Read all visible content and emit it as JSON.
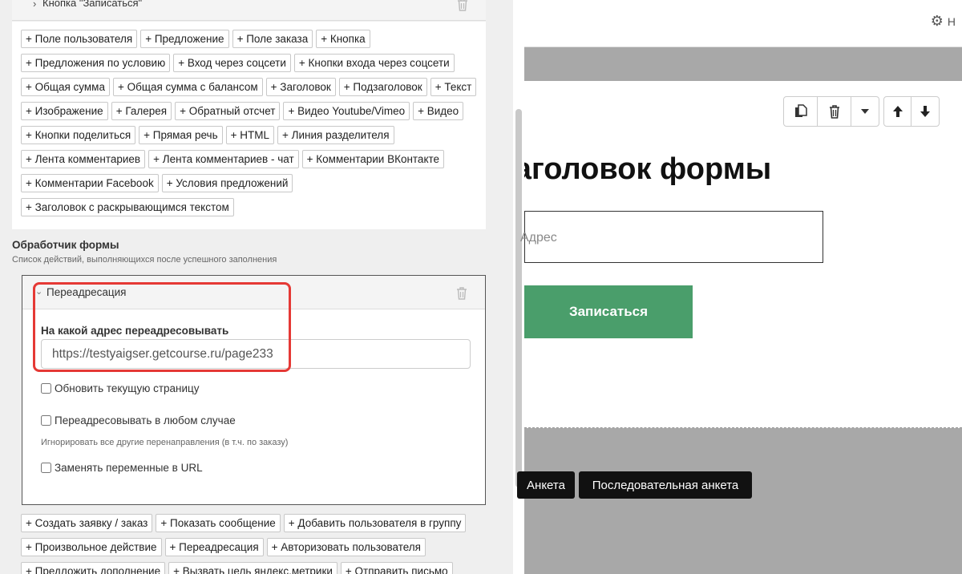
{
  "top_card": {
    "label": "Кнопка \"Записаться\""
  },
  "add_blocks": [
    "+ Поле пользователя",
    "+ Предложение",
    "+ Поле заказа",
    "+ Кнопка",
    "+ Предложения по условию",
    "+ Вход через соцсети",
    "+ Кнопки входа через соцсети",
    "+ Общая сумма",
    "+ Общая сумма с балансом",
    "+ Заголовок",
    "+ Подзаголовок",
    "+ Текст",
    "+ Изображение",
    "+ Галерея",
    "+ Обратный отсчет",
    "+ Видео Youtube/Vimeo",
    "+ Видео",
    "+ Кнопки поделиться",
    "+ Прямая речь",
    "+ HTML",
    "+ Линия разделителя",
    "+ Лента комментариев",
    "+ Лента комментариев - чат",
    "+ Комментарии ВКонтакте",
    "+ Комментарии Facebook",
    "+ Условия предложений",
    "+ Заголовок с раскрывающимся текстом"
  ],
  "handler": {
    "title": "Обработчик формы",
    "subtitle": "Список действий, выполняющихся после успешного заполнения"
  },
  "redirect": {
    "header": "Переадресация",
    "field_label": "На какой адрес переадресовывать",
    "url_value": "https://testyaigser.getcourse.ru/page233",
    "refresh_label": "Обновить текущую страницу",
    "always_label": "Переадресовывать в любом случае",
    "always_hint": "Игнорировать все другие перенаправления (в т.ч. по заказу)",
    "replace_vars_label": "Заменять переменные в URL"
  },
  "add_actions": [
    "+ Создать заявку / заказ",
    "+ Показать сообщение",
    "+ Добавить пользователя в группу",
    "+ Произвольное действие",
    "+ Переадресация",
    "+ Авторизовать пользователя",
    "+ Предложить дополнение",
    "+ Вызвать цель яндекс.метрики",
    "+ Отправить письмо"
  ],
  "preview": {
    "settings_letter": "Н",
    "form_title": "Заголовок формы",
    "email_placeholder": "Адрес",
    "submit_label": "Записаться",
    "pill_survey": "Анкета",
    "pill_sequential": "Последовательная анкета"
  },
  "colors": {
    "highlight": "#e53935",
    "submit_bg": "#4a9e6b",
    "preview_bg": "#a8a8a8"
  }
}
